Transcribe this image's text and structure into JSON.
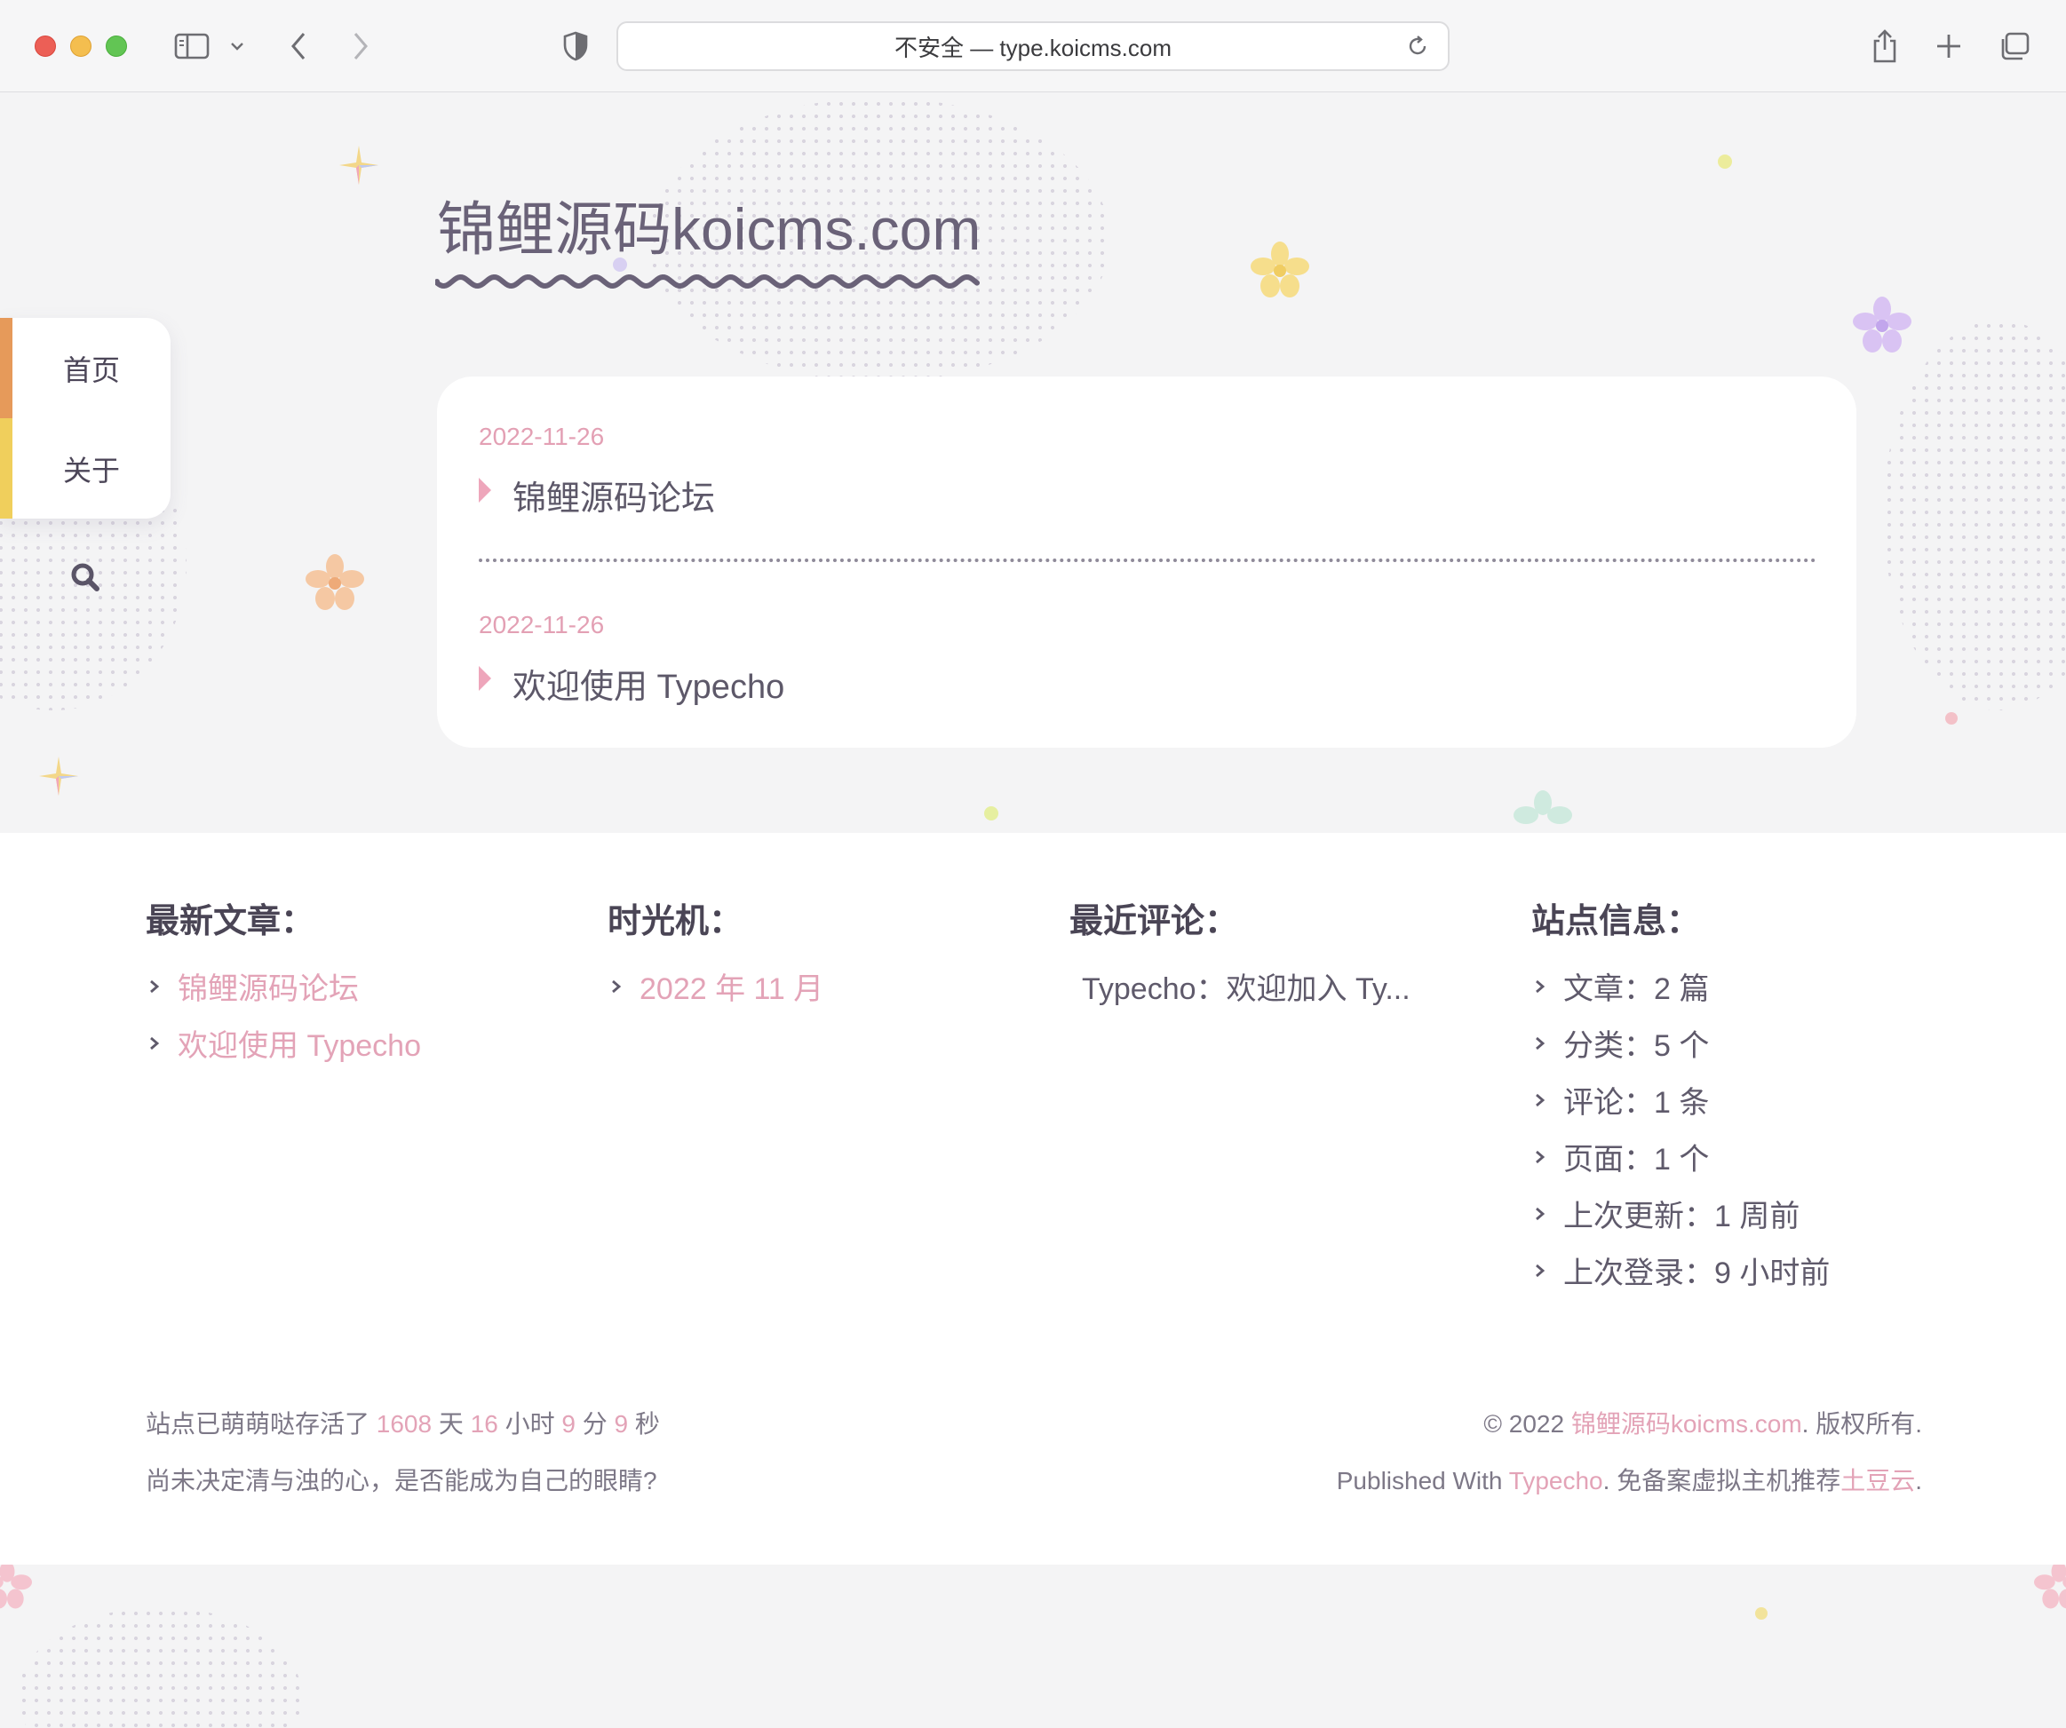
{
  "browser": {
    "address": "不安全 — type.koicms.com"
  },
  "site": {
    "title": "锦鲤源码koicms.com"
  },
  "nav": {
    "items": [
      {
        "label": "首页"
      },
      {
        "label": "关于"
      }
    ]
  },
  "posts": [
    {
      "date": "2022-11-26",
      "title": "锦鲤源码论坛"
    },
    {
      "date": "2022-11-26",
      "title": "欢迎使用 Typecho"
    }
  ],
  "footer": {
    "latest": {
      "title": "最新文章：",
      "items": [
        "锦鲤源码论坛",
        "欢迎使用 Typecho"
      ]
    },
    "archive": {
      "title": "时光机：",
      "items": [
        "2022 年 11 月"
      ]
    },
    "comments": {
      "title": "最近评论：",
      "items": [
        "Typecho：欢迎加入 Ty..."
      ]
    },
    "stats": {
      "title": "站点信息：",
      "items": [
        "文章：2 篇",
        "分类：5 个",
        "评论：1 条",
        "页面：1 个",
        "上次更新：1 周前",
        "上次登录：9 小时前"
      ]
    },
    "uptime": {
      "prefix": "站点已萌萌哒存活了 ",
      "days": "1608",
      "days_unit": " 天 ",
      "hours": "16",
      "hours_unit": " 小时 ",
      "minutes": "9",
      "minutes_unit": " 分 ",
      "seconds": "9",
      "seconds_unit": " 秒"
    },
    "motto": "尚未决定清与浊的心，是否能成为自己的眼睛?",
    "copyright": {
      "prefix": "© 2022 ",
      "site": "锦鲤源码koicms.com",
      "suffix": ". 版权所有."
    },
    "published": {
      "prefix": "Published With ",
      "engine": "Typecho",
      "middle": ". 免备案虚拟主机推荐",
      "host": "土豆云",
      "suffix": "."
    }
  },
  "colors": {
    "accent_pink": "#e3a3b7",
    "nav_orange": "#e69a5a",
    "nav_yellow": "#f0cf5c",
    "title": "#6a6278"
  }
}
